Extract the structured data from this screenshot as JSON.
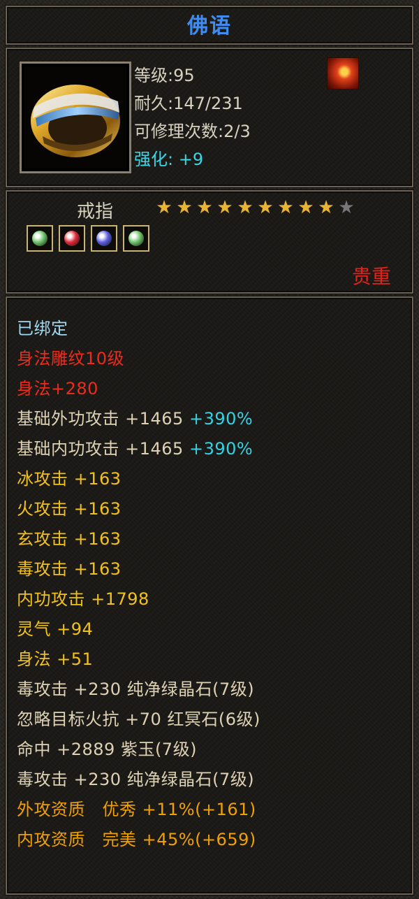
{
  "title": "佛语",
  "info": {
    "level": "等级:95",
    "durability": "耐久:147/231",
    "repair": "可修理次数:2/3",
    "enhance_label": "强化:",
    "enhance_value": "+9"
  },
  "item_type": "戒指",
  "stars": {
    "filled": 9,
    "total": 10
  },
  "gems": [
    {
      "icon": "green-crystal-gem",
      "color": "#6fc36a"
    },
    {
      "icon": "red-gem",
      "color": "#e02a3a"
    },
    {
      "icon": "purple-jade-gem",
      "color": "#5b5fe0"
    },
    {
      "icon": "green-crystal-gem",
      "color": "#6fc36a"
    }
  ],
  "rarity": "贵重",
  "attributes": {
    "bound": "已绑定",
    "engrave": "身法雕纹10级",
    "agility_engrave": "身法+280",
    "base_ext_atk": {
      "label": "基础外功攻击 +1465",
      "pct": "+390%"
    },
    "base_int_atk": {
      "label": "基础内功攻击 +1465",
      "pct": "+390%"
    },
    "ice_atk": "冰攻击 +163",
    "fire_atk": "火攻击 +163",
    "xuan_atk": "玄攻击 +163",
    "poison_atk": "毒攻击 +163",
    "int_atk": "内功攻击 +1798",
    "spirit": "灵气 +94",
    "agility": "身法 +51",
    "gem1": "毒攻击 +230 纯净绿晶石(7级)",
    "gem2": "忽略目标火抗 +70 红冥石(6级)",
    "gem3": "命中 +2889 紫玉(7级)",
    "gem4": "毒攻击 +230 纯净绿晶石(7级)",
    "ext_quality": "外攻资质　优秀 +11%(+161)",
    "int_quality": "内攻资质　完美 +45%(+659)"
  }
}
